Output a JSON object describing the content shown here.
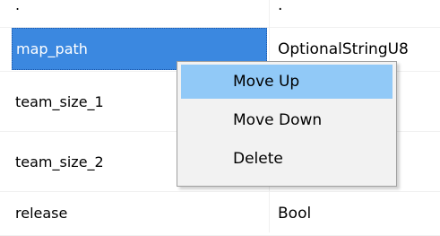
{
  "rows": [
    {
      "name": ".",
      "type": "."
    },
    {
      "name": "map_path",
      "type": "OptionalStringU8"
    },
    {
      "name": "team_size_1",
      "type": ""
    },
    {
      "name": "team_size_2",
      "type": ""
    },
    {
      "name": "release",
      "type": "Bool"
    }
  ],
  "context_menu": {
    "items": [
      {
        "label": "Move Up"
      },
      {
        "label": "Move Down"
      },
      {
        "label": "Delete"
      }
    ]
  },
  "colors": {
    "selection": "#3b88e0",
    "menu_hover": "#91c9f7",
    "menu_bg": "#f2f2f2",
    "grid_line": "#f0f0f0"
  }
}
